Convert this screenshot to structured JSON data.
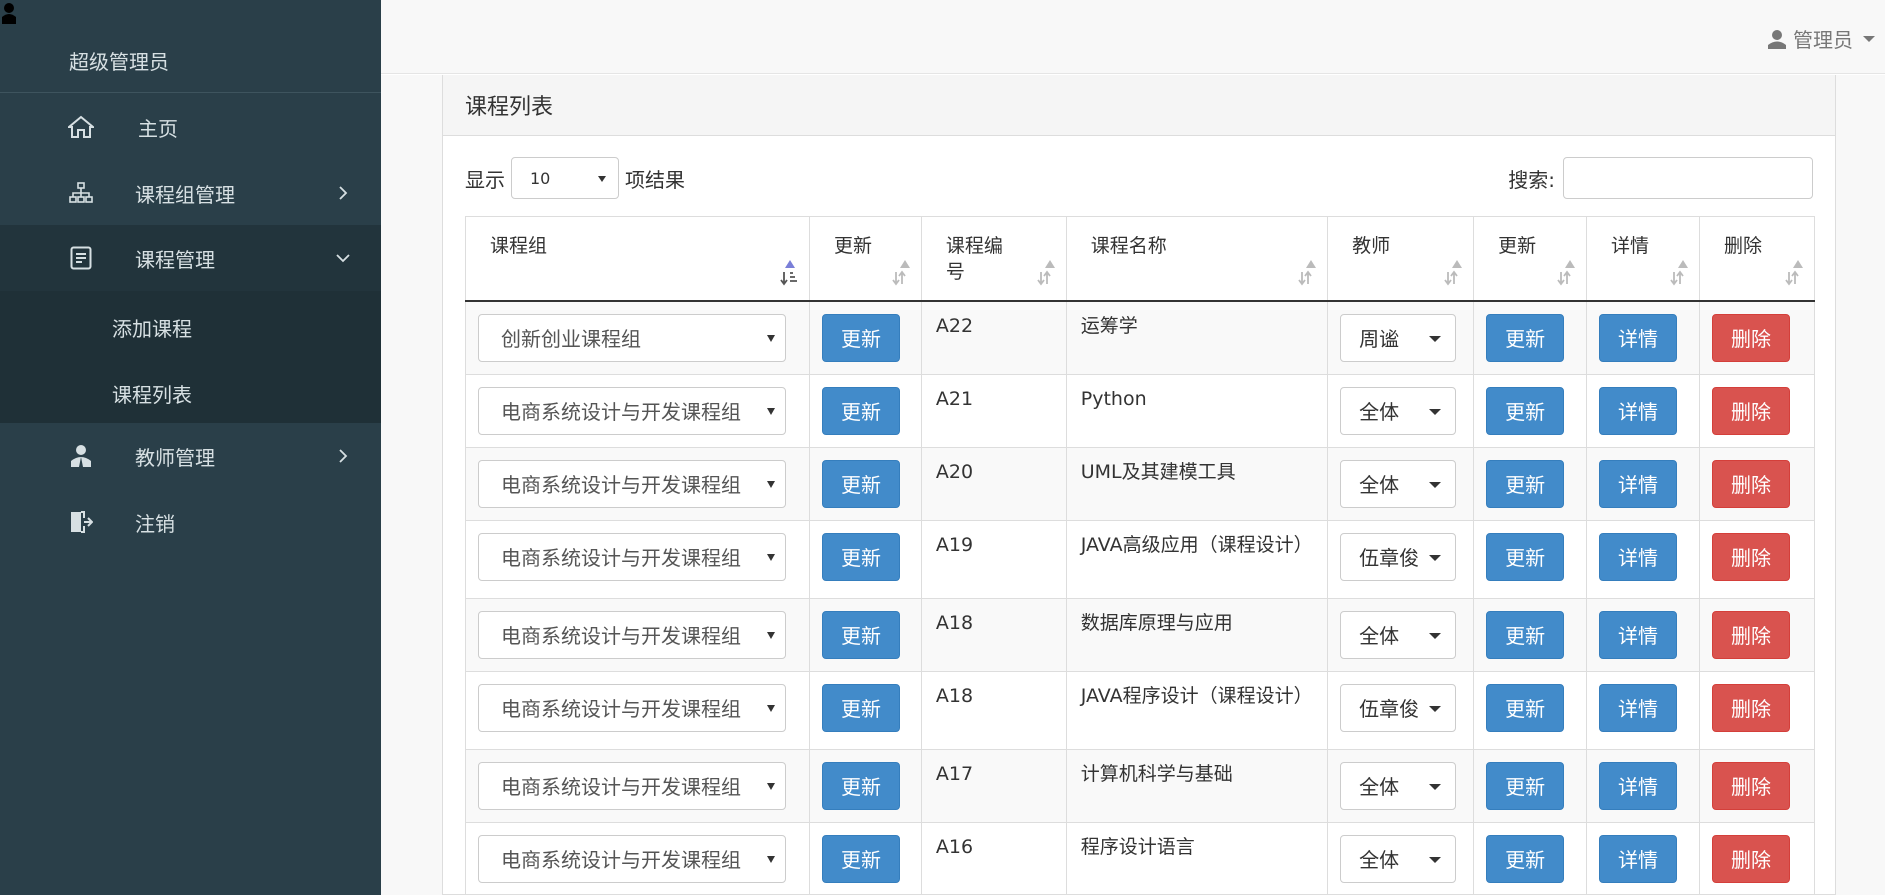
{
  "sidebar": {
    "title": "超级管理员",
    "items": [
      {
        "label": "主页",
        "icon": "home-icon"
      },
      {
        "label": "课程组管理",
        "icon": "sitemap-icon"
      },
      {
        "label": "课程管理",
        "icon": "document-icon"
      },
      {
        "label": "教师管理",
        "icon": "teacher-icon"
      },
      {
        "label": "注销",
        "icon": "logout-icon"
      }
    ],
    "sub_items": [
      {
        "label": "添加课程"
      },
      {
        "label": "课程列表"
      }
    ]
  },
  "topbar": {
    "user_label": "管理员"
  },
  "panel": {
    "title": "课程列表"
  },
  "controls": {
    "show_label": "显示",
    "page_length": "10",
    "results_label": "项结果",
    "search_label": "搜索:"
  },
  "table": {
    "headers": [
      "课程组",
      "更新",
      "课程编号",
      "课程名称",
      "教师",
      "更新",
      "详情",
      "删除"
    ],
    "rows": [
      {
        "group": "创新创业课程组",
        "update1": "更新",
        "code": "A22",
        "name": "运筹学",
        "teacher": "周谧",
        "update2": "更新",
        "detail": "详情",
        "delete": "删除"
      },
      {
        "group": "电商系统设计与开发课程组",
        "update1": "更新",
        "code": "A21",
        "name": "Python",
        "teacher": "全体",
        "update2": "更新",
        "detail": "详情",
        "delete": "删除"
      },
      {
        "group": "电商系统设计与开发课程组",
        "update1": "更新",
        "code": "A20",
        "name": "UML及其建模工具",
        "teacher": "全体",
        "update2": "更新",
        "detail": "详情",
        "delete": "删除"
      },
      {
        "group": "电商系统设计与开发课程组",
        "update1": "更新",
        "code": "A19",
        "name": "JAVA高级应用（课程设计）",
        "teacher": "伍章俊",
        "update2": "更新",
        "detail": "详情",
        "delete": "删除"
      },
      {
        "group": "电商系统设计与开发课程组",
        "update1": "更新",
        "code": "A18",
        "name": "数据库原理与应用",
        "teacher": "全体",
        "update2": "更新",
        "detail": "详情",
        "delete": "删除"
      },
      {
        "group": "电商系统设计与开发课程组",
        "update1": "更新",
        "code": "A18",
        "name": "JAVA程序设计（课程设计）",
        "teacher": "伍章俊",
        "update2": "更新",
        "detail": "详情",
        "delete": "删除"
      },
      {
        "group": "电商系统设计与开发课程组",
        "update1": "更新",
        "code": "A17",
        "name": "计算机科学与基础",
        "teacher": "全体",
        "update2": "更新",
        "detail": "详情",
        "delete": "删除"
      },
      {
        "group": "电商系统设计与开发课程组",
        "update1": "更新",
        "code": "A16",
        "name": "程序设计语言",
        "teacher": "全体",
        "update2": "更新",
        "detail": "详情",
        "delete": "删除"
      }
    ]
  },
  "colors": {
    "sidebar_bg": "#2a3f49",
    "primary": "#428bca",
    "danger": "#d9534f"
  }
}
